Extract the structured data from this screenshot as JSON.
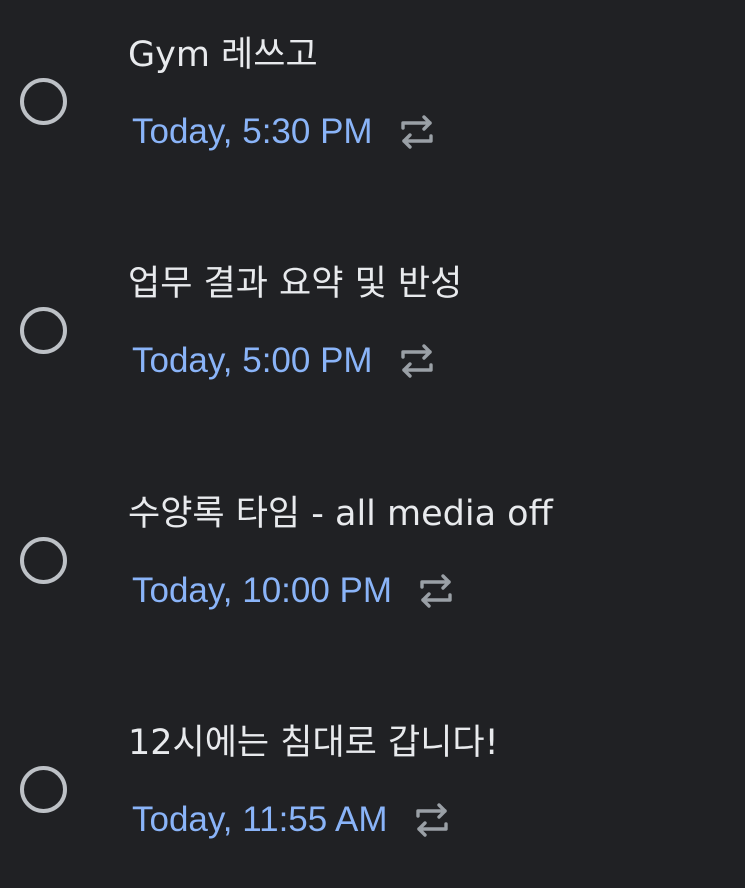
{
  "tasks": [
    {
      "title": "Gym 레쓰고",
      "due": "Today, 5:30 PM",
      "repeat_icon": "repeat-icon"
    },
    {
      "title": "업무 결과 요약 및 반성",
      "due": "Today, 5:00 PM",
      "repeat_icon": "repeat-icon"
    },
    {
      "title": "수양록 타임 - all media off",
      "due": "Today, 10:00 PM",
      "repeat_icon": "repeat-icon"
    },
    {
      "title": "12시에는 침대로 갑니다!",
      "due": "Today, 11:55 AM",
      "repeat_icon": "repeat-icon"
    }
  ],
  "colors": {
    "background": "#202124",
    "title": "#e8eaed",
    "due": "#8ab4f8",
    "checkbox": "#bdc1c6",
    "icon": "#9aa0a6"
  }
}
